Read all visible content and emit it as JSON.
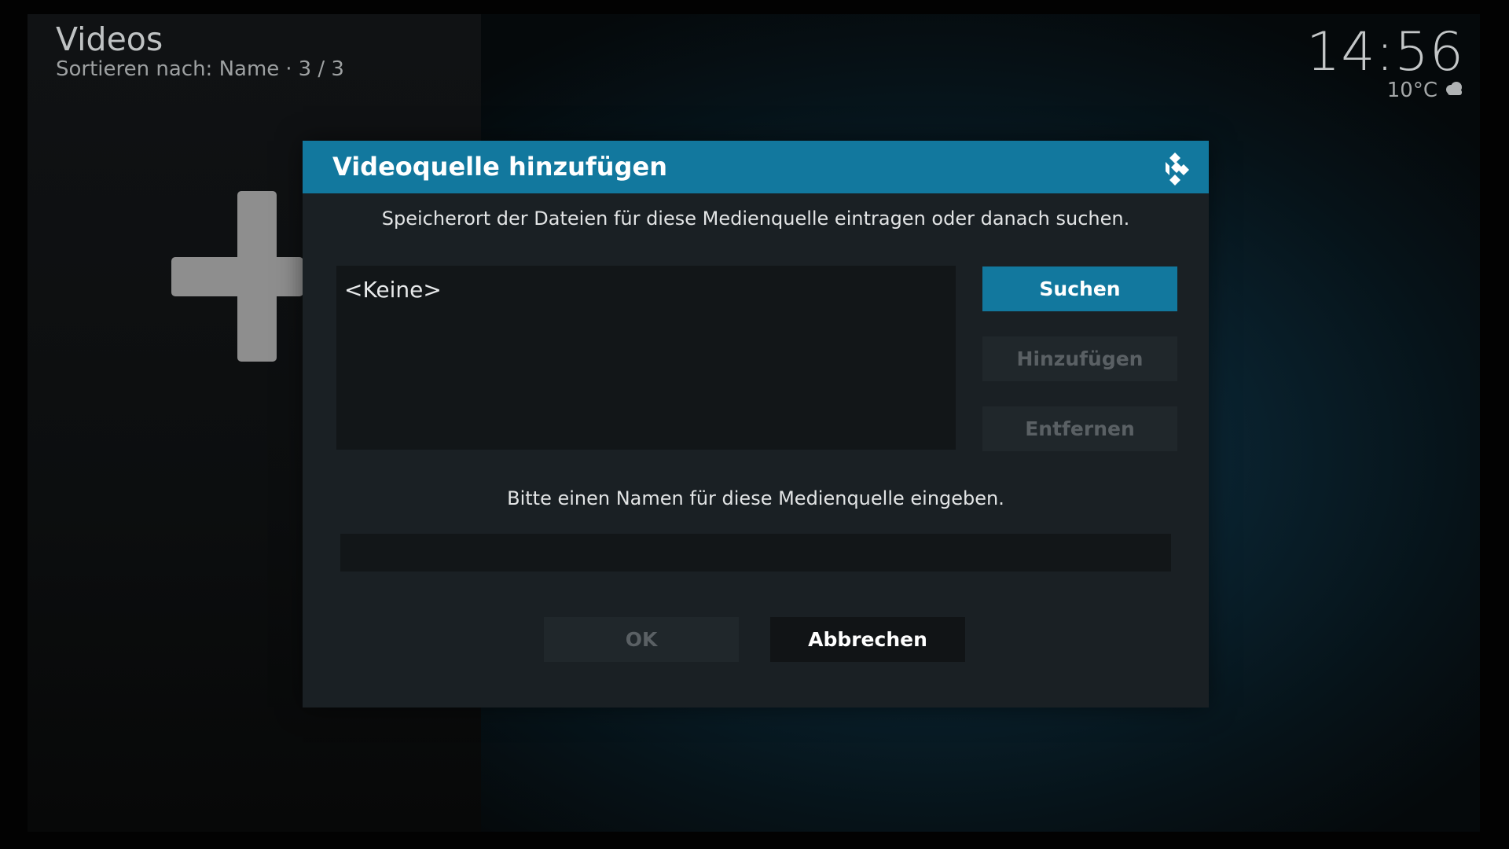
{
  "header": {
    "title": "Videos",
    "sort_label": "Sortieren nach: Name",
    "separator": "·",
    "count": "3 / 3"
  },
  "clock": {
    "time": "14:56",
    "temperature": "10°C",
    "weather_icon": "cloud-icon"
  },
  "background": {
    "add_icon": "plus-icon"
  },
  "dialog": {
    "title": "Videoquelle hinzufügen",
    "logo_icon": "kodi-logo-icon",
    "description": "Speicherort der Dateien für diese Medienquelle eintragen oder danach suchen.",
    "paths": [
      "<Keine>"
    ],
    "buttons": {
      "search": "Suchen",
      "add": "Hinzufügen",
      "remove": "Entfernen",
      "ok": "OK",
      "cancel": "Abbrechen"
    },
    "name_prompt": "Bitte einen Namen für diese Medienquelle eingeben.",
    "name_value": ""
  },
  "colors": {
    "accent": "#12789e",
    "dialog_bg": "#1a2024",
    "field_bg": "#121618"
  }
}
